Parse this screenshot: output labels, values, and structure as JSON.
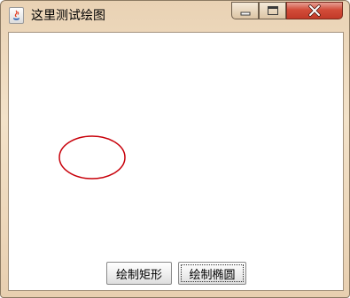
{
  "window": {
    "title": "这里测试绘图",
    "controls": {
      "minimize_icon": "minimize-icon",
      "maximize_icon": "maximize-icon",
      "close_icon": "close-icon"
    },
    "app_icon": "java-icon"
  },
  "buttons": {
    "draw_rect": "绘制矩形",
    "draw_oval": "绘制椭圆"
  },
  "drawing": {
    "shape": "ellipse",
    "stroke_color": "#c8000a"
  },
  "colors": {
    "close_button": "#d24c39",
    "frame": "#e9d2b4"
  }
}
